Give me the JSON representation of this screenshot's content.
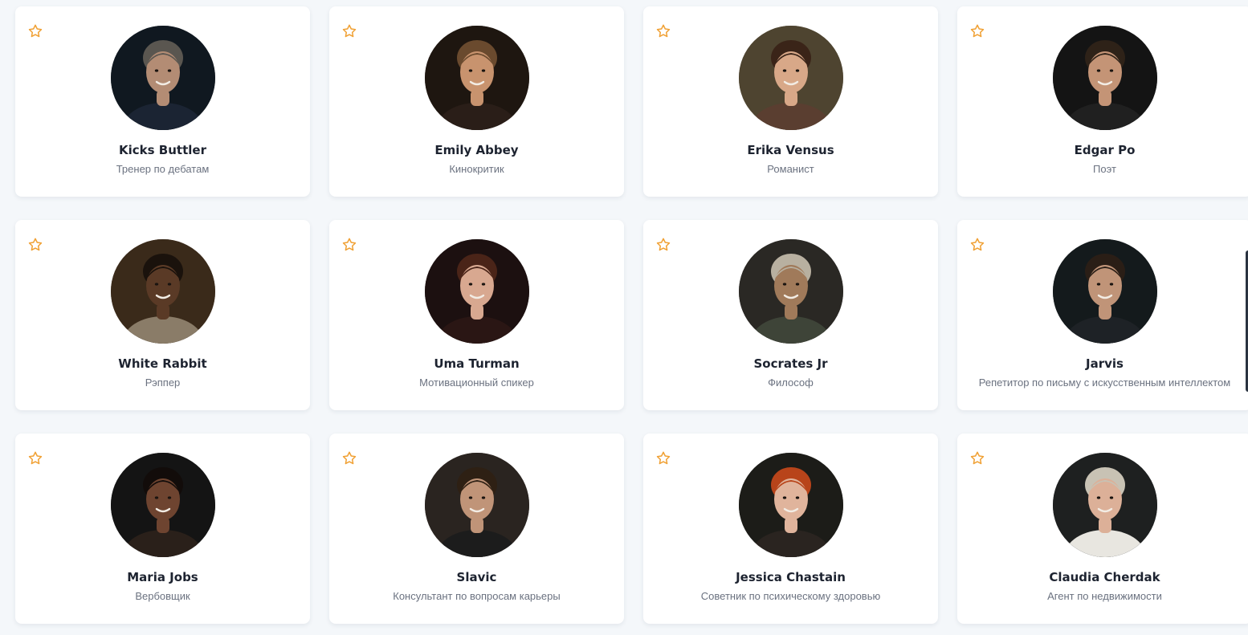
{
  "colors": {
    "star": "#f0a033",
    "name": "#1d2330",
    "role": "#6b7280",
    "background": "#f4f7fa"
  },
  "cards": [
    {
      "name": "Kicks Buttler",
      "role": "Тренер по дебатам",
      "avatar": {
        "bg": "#101820",
        "skin": "#b38c74",
        "hair": "#5a5650",
        "cloth": "#1b2433"
      }
    },
    {
      "name": "Emily Abbey",
      "role": "Кинокритик",
      "avatar": {
        "bg": "#1e1610",
        "skin": "#c8936e",
        "hair": "#6a4a2e",
        "cloth": "#2a1e18"
      }
    },
    {
      "name": "Erika Vensus",
      "role": "Романист",
      "avatar": {
        "bg": "#4e4430",
        "skin": "#d8a888",
        "hair": "#3a2418",
        "cloth": "#5a3e30"
      }
    },
    {
      "name": "Edgar Po",
      "role": "Поэт",
      "avatar": {
        "bg": "#141414",
        "skin": "#c49476",
        "hair": "#2e2218",
        "cloth": "#202020"
      }
    },
    {
      "name": "White Rabbit",
      "role": "Рэппер",
      "avatar": {
        "bg": "#3a2a1a",
        "skin": "#5a3a26",
        "hair": "#1a120c",
        "cloth": "#8a7c68"
      }
    },
    {
      "name": "Uma Turman",
      "role": "Мотивационный спикер",
      "avatar": {
        "bg": "#1c1010",
        "skin": "#d8a890",
        "hair": "#4a2418",
        "cloth": "#2a1614"
      }
    },
    {
      "name": "Socrates Jr",
      "role": "Философ",
      "avatar": {
        "bg": "#2a2824",
        "skin": "#a07a5a",
        "hair": "#b8b0a0",
        "cloth": "#3e4438"
      }
    },
    {
      "name": "Jarvis",
      "role": "Репетитор по письму с искусственным интеллектом",
      "avatar": {
        "bg": "#141a1c",
        "skin": "#c09478",
        "hair": "#2a1e16",
        "cloth": "#1e2226"
      }
    },
    {
      "name": "Maria Jobs",
      "role": "Вербовщик",
      "avatar": {
        "bg": "#141414",
        "skin": "#6e4430",
        "hair": "#120c0a",
        "cloth": "#2a201a"
      }
    },
    {
      "name": "Slavic",
      "role": "Консультант по вопросам карьеры",
      "avatar": {
        "bg": "#2a2420",
        "skin": "#c09478",
        "hair": "#2e2014",
        "cloth": "#1c1c1c"
      }
    },
    {
      "name": "Jessica Chastain",
      "role": "Советник по психическому здоровью",
      "avatar": {
        "bg": "#1c1c18",
        "skin": "#e0b49c",
        "hair": "#b8441a",
        "cloth": "#2a2420"
      }
    },
    {
      "name": "Claudia Cherdak",
      "role": "Агент по недвижимости",
      "avatar": {
        "bg": "#1e2020",
        "skin": "#dcb098",
        "hair": "#c8c2b4",
        "cloth": "#e8e6e0"
      }
    }
  ]
}
